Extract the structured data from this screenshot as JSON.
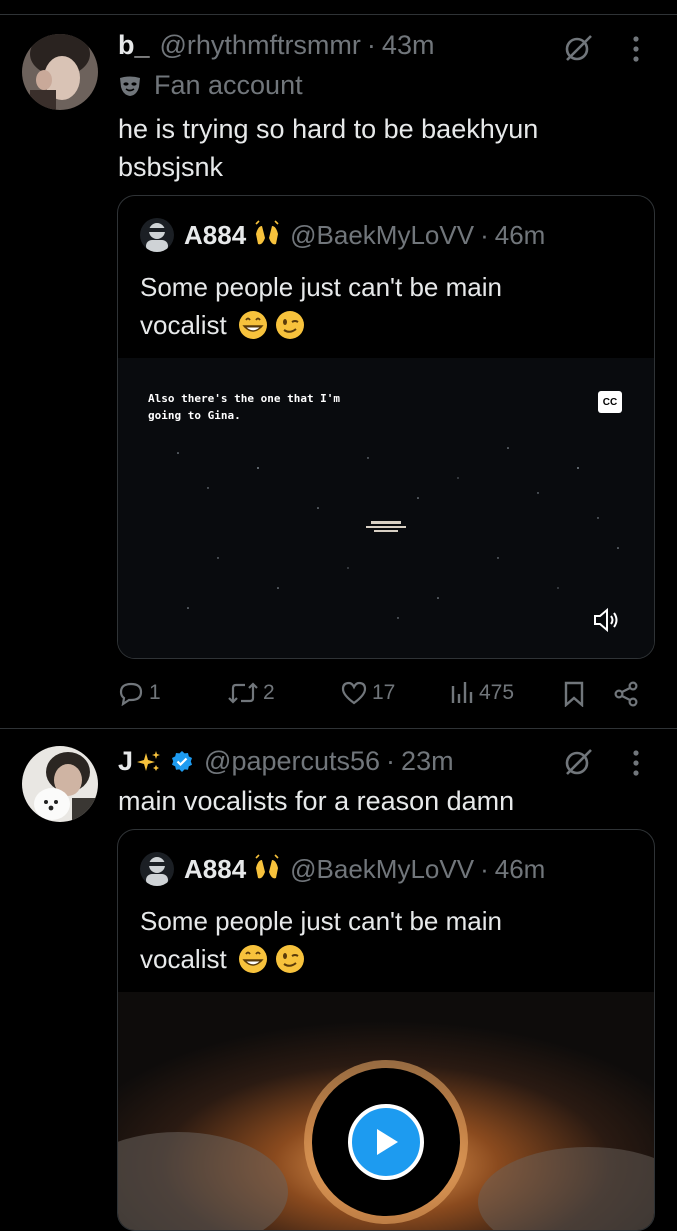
{
  "tweets": [
    {
      "name": "b_",
      "handle": "@rhythmftrsmmr",
      "time": "43m",
      "label": "Fan account",
      "text_line1": "he is trying so hard to be baekhyun",
      "text_line2": "bsbsjsnk",
      "quote": {
        "name": "A884",
        "handle": "@BaekMyLoVV",
        "time": "46m",
        "text_line1": "Some people just can't be main",
        "text_line2": "vocalist",
        "caption_line1": "Also there's the one that I'm",
        "caption_line2": "going to Gina.",
        "cc_label": "CC"
      },
      "stats": {
        "replies": "1",
        "retweets": "2",
        "likes": "17",
        "views": "475"
      }
    },
    {
      "name": "J",
      "handle": "@papercuts56",
      "time": "23m",
      "text_line1": "main vocalists for a reason damn",
      "quote": {
        "name": "A884",
        "handle": "@BaekMyLoVV",
        "time": "46m",
        "text_line1": "Some people just can't be main",
        "text_line2": "vocalist"
      }
    }
  ],
  "separator": "·",
  "colors": {
    "background": "#000000",
    "text": "#e7e9ea",
    "muted": "#71767b",
    "border": "#2f3336",
    "verified": "#1d9bf0",
    "play": "#1d9bf0"
  },
  "icons": [
    "grok-icon",
    "more-icon",
    "mask-icon",
    "reply-icon",
    "retweet-icon",
    "like-icon",
    "views-icon",
    "bookmark-icon",
    "share-icon",
    "volume-icon",
    "play-icon",
    "verified-badge-icon"
  ]
}
